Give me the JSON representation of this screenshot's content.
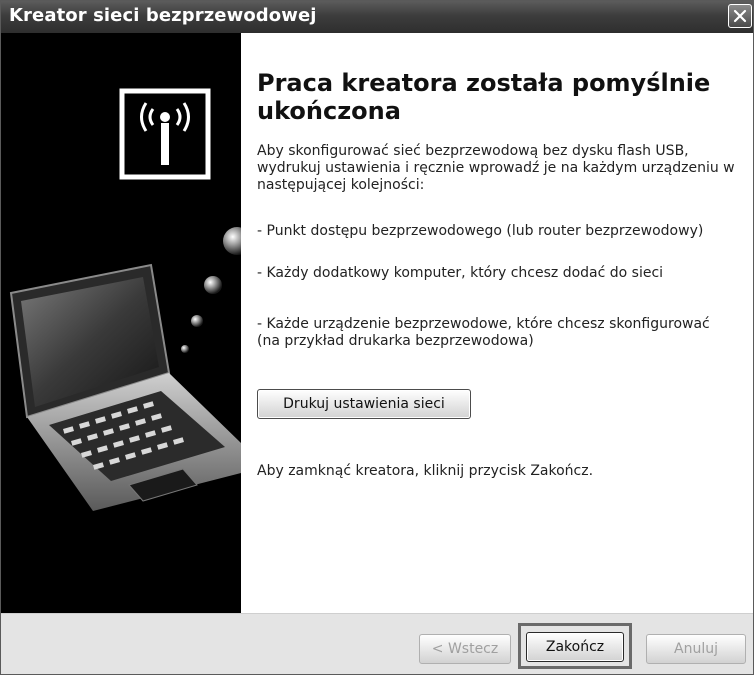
{
  "window": {
    "title": "Kreator sieci bezprzewodowej",
    "close_icon": "close-icon"
  },
  "sidebar": {
    "icons": [
      "wireless-antenna-icon",
      "laptop-illustration"
    ]
  },
  "content": {
    "heading": "Praca kreatora została pomyślnie ukończona",
    "intro": "Aby skonfigurować sieć bezprzewodową bez dysku flash USB, wydrukuj ustawienia i ręcznie wprowadź je na każdym urządzeniu w następującej kolejności:",
    "steps": [
      "- Punkt dostępu bezprzewodowego (lub router bezprzewodowy)",
      "- Każdy dodatkowy komputer, który chcesz dodać do sieci",
      "- Każde urządzenie bezprzewodowe, które chcesz skonfigurować (na przykład drukarka bezprzewodowa)"
    ],
    "print_button": "Drukuj ustawienia sieci",
    "closing": "Aby zamknąć kreatora, kliknij przycisk Zakończ."
  },
  "footer": {
    "back_button": "< Wstecz",
    "finish_button": "Zakończ",
    "cancel_button": "Anuluj"
  },
  "colors": {
    "titlebar": "#3d3d3d",
    "sidebar": "#000000",
    "footer": "#e4e4e4",
    "highlight_frame": "#6a6a6a"
  }
}
